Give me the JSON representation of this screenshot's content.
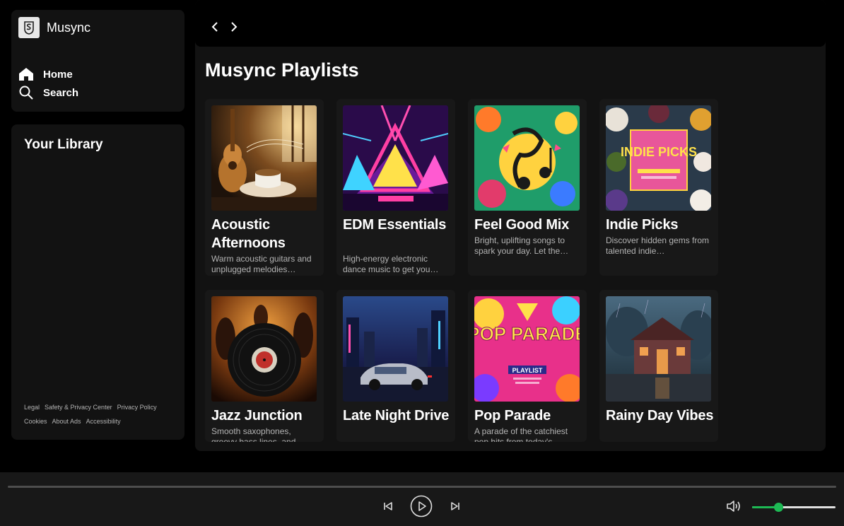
{
  "brand": {
    "name": "Musync",
    "logo_icon": "musync-logo-icon"
  },
  "nav": [
    {
      "label": "Home",
      "icon": "home-icon"
    },
    {
      "label": "Search",
      "icon": "search-icon"
    }
  ],
  "library": {
    "title": "Your Library",
    "footer_links": [
      [
        "Legal",
        "Safety & Privacy Center",
        "Privacy Policy"
      ],
      [
        "Cookies",
        "About Ads",
        "Accessibility"
      ]
    ]
  },
  "main": {
    "title": "Musync Playlists",
    "playlists": [
      {
        "title": "Acoustic Afternoons",
        "description": "Warm acoustic guitars and unplugged melodies…"
      },
      {
        "title": "EDM Essentials",
        "description": "High-energy electronic dance music to get you…"
      },
      {
        "title": "Feel Good Mix",
        "description": "Bright, uplifting songs to spark your day. Let the…"
      },
      {
        "title": "Indie Picks",
        "description": "Discover hidden gems from talented indie…"
      },
      {
        "title": "Jazz Junction",
        "description": "Smooth saxophones, groovy bass lines, and…"
      },
      {
        "title": "Late Night Drive",
        "description": ""
      },
      {
        "title": "Pop Parade",
        "description": "A parade of the catchiest pop hits from today's…"
      },
      {
        "title": "Rainy Day Vibes",
        "description": ""
      }
    ],
    "cover_text": {
      "indie": "INDIE PICKS",
      "pop": "POP PARADE",
      "pop_sub": "PLAYLIST"
    }
  },
  "player": {
    "progress": 0,
    "volume": 0.32,
    "accent": "#1db954",
    "icons": [
      "previous-icon",
      "play-icon",
      "next-icon",
      "volume-icon"
    ]
  }
}
